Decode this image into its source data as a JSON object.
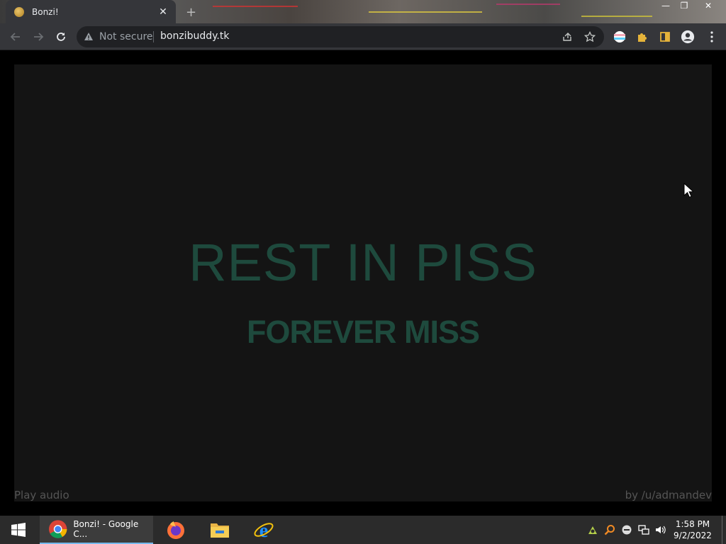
{
  "browser": {
    "tab": {
      "title": "Bonzi!",
      "close_glyph": "✕"
    },
    "new_tab_glyph": "+",
    "window_controls": {
      "minimize": "—",
      "maximize": "❐",
      "close": "✕"
    },
    "security_label": "Not secure",
    "url": "bonzibuddy.tk",
    "icons": [
      "back-icon",
      "forward-icon",
      "reload-icon",
      "warning-icon",
      "share-icon",
      "bookmark-star-icon",
      "flag-extension-icon",
      "puzzle-extensions-icon",
      "side-panel-icon",
      "profile-avatar-icon",
      "menu-dots-icon"
    ]
  },
  "page": {
    "headline": "REST IN PISS",
    "subline": "FOREVER MISS",
    "play_audio": "Play audio",
    "credit": "by /u/admandev",
    "colors": {
      "background": "#141414",
      "headline": "#1e4a3d",
      "footer_text": "#555555"
    }
  },
  "taskbar": {
    "active_app_label": "Bonzi! - Google C...",
    "apps": [
      "chrome-icon",
      "firefox-icon",
      "file-explorer-icon",
      "internet-explorer-icon"
    ],
    "tray_icons": [
      "tray-app-icon",
      "search-tray-icon",
      "status-tray-icon",
      "network-icon",
      "volume-icon"
    ],
    "time": "1:58 PM",
    "date": "9/2/2022"
  }
}
